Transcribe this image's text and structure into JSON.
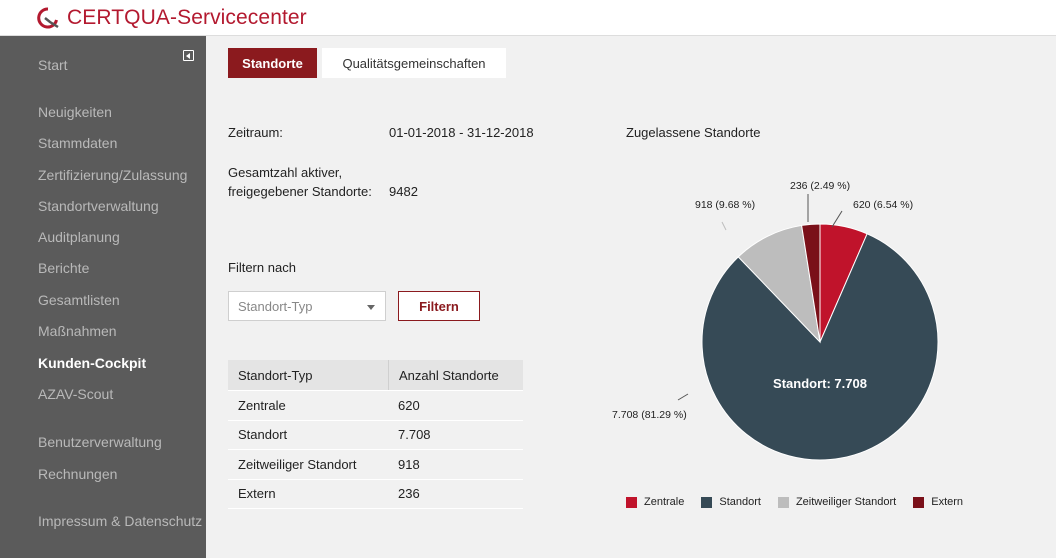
{
  "header": {
    "title": "CERTQUA-Servicecenter"
  },
  "sidebar": {
    "items": [
      {
        "label": "Start"
      },
      {
        "label": "Neuigkeiten"
      },
      {
        "label": "Stammdaten"
      },
      {
        "label": "Zertifizierung/Zulassung"
      },
      {
        "label": "Standortverwaltung"
      },
      {
        "label": "Auditplanung"
      },
      {
        "label": "Berichte"
      },
      {
        "label": "Gesamtlisten"
      },
      {
        "label": "Maßnahmen"
      },
      {
        "label": "Kunden-Cockpit",
        "active": true
      },
      {
        "label": "AZAV-Scout"
      },
      {
        "label": "Benutzerverwaltung"
      },
      {
        "label": "Rechnungen"
      },
      {
        "label": "Impressum & Datenschutz"
      }
    ]
  },
  "tabs": [
    {
      "label": "Standorte",
      "active": true
    },
    {
      "label": "Qualitätsgemeinschaften",
      "active": false
    }
  ],
  "info": {
    "period_label": "Zeitraum:",
    "period_value": "01-01-2018 - 31-12-2018",
    "total_label_line1": "Gesamtzahl aktiver,",
    "total_label_line2": "freigegebener Standorte:",
    "total_value": "9482"
  },
  "filter": {
    "heading": "Filtern nach",
    "select_placeholder": "Standort-Typ",
    "button_label": "Filtern"
  },
  "table": {
    "headers": [
      "Standort-Typ",
      "Anzahl Standorte"
    ],
    "rows": [
      [
        "Zentrale",
        "620"
      ],
      [
        "Standort",
        "7.708"
      ],
      [
        "Zeitweiliger Standort",
        "918"
      ],
      [
        "Extern",
        "236"
      ]
    ]
  },
  "colors": {
    "brand": "#b3192f",
    "accent_dark": "#8b1a1e",
    "zentrale": "#c0132b",
    "standort": "#364a56",
    "zeitweilig": "#bdbdbd",
    "extern": "#7a1019"
  },
  "chart_data": {
    "type": "pie",
    "title": "Zugelassene Standorte",
    "slices": [
      {
        "name": "Zentrale",
        "value": 620,
        "label": "620 (6.54 %)"
      },
      {
        "name": "Standort",
        "value": 7708,
        "label": "7.708 (81.29 %)"
      },
      {
        "name": "Zeitweiliger Standort",
        "value": 918,
        "label": "918 (9.68 %)"
      },
      {
        "name": "Extern",
        "value": 236,
        "label": "236 (2.49 %)"
      }
    ],
    "center_label": "Standort: 7.708",
    "legend": [
      "Zentrale",
      "Standort",
      "Zeitweiliger Standort",
      "Extern"
    ],
    "legend_placement": "bottom"
  }
}
